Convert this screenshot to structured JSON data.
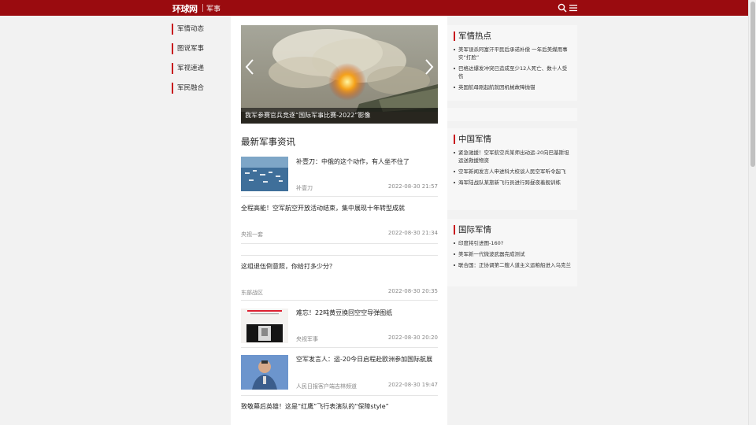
{
  "header": {
    "logo": "环球网",
    "channel": "军事"
  },
  "left_nav": {
    "items": [
      {
        "label": "军情动态"
      },
      {
        "label": "图说军事"
      },
      {
        "label": "军视速递"
      },
      {
        "label": "军民融合"
      }
    ]
  },
  "carousel": {
    "caption": "我军参赛官兵竞逐“国际军事比赛-2022”影像"
  },
  "main": {
    "section_title": "最新军事资讯",
    "news": [
      {
        "title": "补壹刀：中俄的这个动作，有人坐不住了",
        "source": "补壹刀",
        "time": "2022-08-30 21:57",
        "thumb": "ships"
      },
      {
        "title": "全程高能！空军航空开放活动结束，集中展现十年转型成就",
        "source": "央视一套",
        "time": "2022-08-30 21:34",
        "thumb": ""
      },
      {
        "title": "这组退伍倒意照，你给打多少分？",
        "source": "东部战区",
        "time": "2022-08-30 20:35",
        "thumb": ""
      },
      {
        "title": "难忘！22吨黄豆换回空空导弹图纸",
        "source": "央视军事",
        "time": "2022-08-30 20:20",
        "thumb": "document"
      },
      {
        "title": "空军发言人：运-20今日启程赴欧洲参加国际航展",
        "source": "人民日报客户端吉林频道",
        "time": "2022-08-30 19:47",
        "thumb": "spokesman"
      },
      {
        "title": "致敬幕后英雄！这是“红鹰”飞行表演队的“保障style”",
        "source": "",
        "time": "",
        "thumb": ""
      }
    ]
  },
  "sidebar": {
    "boxes": [
      {
        "title": "军情热点",
        "items": [
          "美军误杀阿富汗平民后承诺补偿 一年后美媒用事实“打脸”",
          "巴格达爆发冲突已造成至少12人死亡、数十人受伤",
          "英国航母刚起航就因机械故障抛锚"
        ]
      },
      {
        "title": "中国军情",
        "items": [
          "紧急驰援！空军航空兵某师出动运-20向巴基斯坦运送救援物资",
          "空军新闻发言人申进科大校谈人民空军听令起飞",
          "海军陆战队某旅新飞行员进行跨昼夜着舰训练"
        ]
      },
      {
        "title": "国际军情",
        "items": [
          "印度将引进图-160?",
          "美军新一代微波武器完成测试",
          "联合国：正协调第二艘人道主义运粮船进入乌克兰"
        ]
      }
    ]
  },
  "colors": {
    "brand_red": "#9a0b0f",
    "accent_red": "#c8161d"
  },
  "icons": {
    "search": "search-icon",
    "menu": "menu-icon",
    "prev": "chevron-left-icon",
    "next": "chevron-right-icon"
  }
}
